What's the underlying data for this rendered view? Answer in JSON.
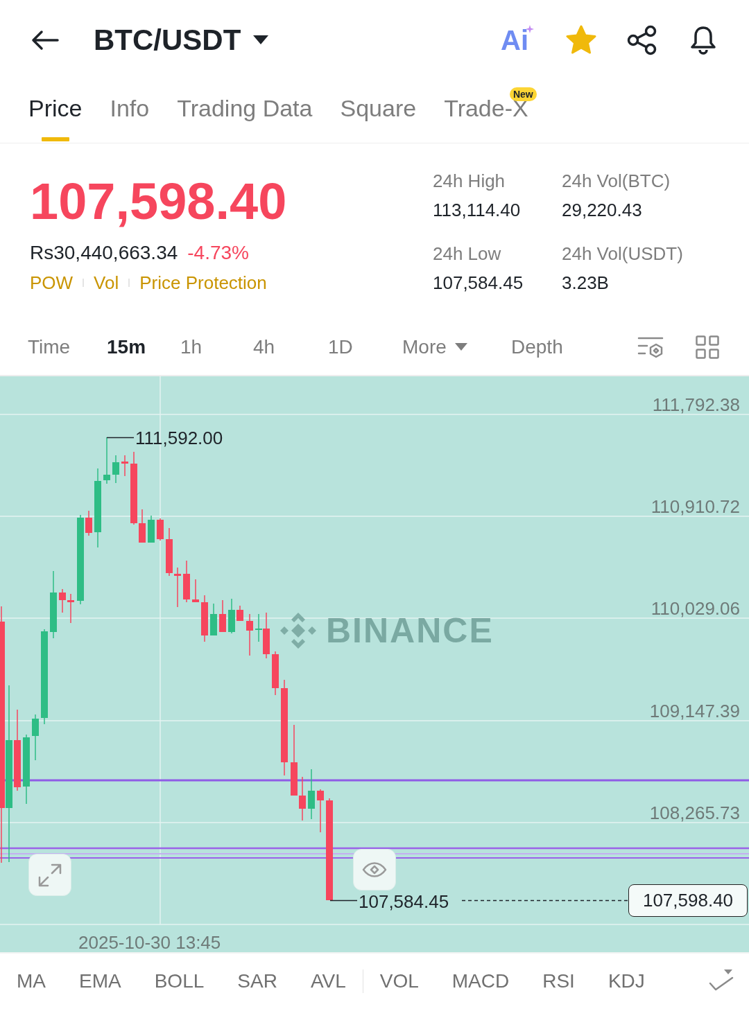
{
  "header": {
    "title": "BTC/USDT",
    "ai_label": "Ai",
    "favorite": true
  },
  "tabs": [
    {
      "label": "Price",
      "selected": true
    },
    {
      "label": "Info",
      "selected": false
    },
    {
      "label": "Trading Data",
      "selected": false
    },
    {
      "label": "Square",
      "selected": false
    },
    {
      "label": "Trade-X",
      "selected": false,
      "badge": "New"
    }
  ],
  "ticker": {
    "price": "107,598.40",
    "falling": true,
    "fiat_price": "Rs30,440,663.34",
    "change": "-4.73%",
    "tags": [
      "POW",
      "Vol",
      "Price Protection"
    ]
  },
  "stats": [
    {
      "label": "24h High",
      "value": "113,114.40"
    },
    {
      "label": "24h Vol(BTC)",
      "value": "29,220.43"
    },
    {
      "label": "24h Low",
      "value": "107,584.45"
    },
    {
      "label": "24h Vol(USDT)",
      "value": "3.23B"
    }
  ],
  "intervals": [
    {
      "label": "Time",
      "kind": "option",
      "selected": false
    },
    {
      "label": "15m",
      "kind": "option",
      "selected": true
    },
    {
      "label": "1h",
      "kind": "option",
      "selected": false
    },
    {
      "label": "4h",
      "kind": "option",
      "selected": false
    },
    {
      "label": "1D",
      "kind": "option",
      "selected": false
    },
    {
      "label": "More",
      "kind": "dropdown",
      "selected": false
    },
    {
      "label": "Depth",
      "kind": "option",
      "selected": false
    }
  ],
  "chart": {
    "logo_text": "BINANCE",
    "price_axis": [
      "111,792.38",
      "110,910.72",
      "110,029.06",
      "109,147.39",
      "108,265.73"
    ],
    "high_label": "111,592.00",
    "low_label": "107,584.45",
    "current_price": "107,598.40",
    "time_label": "2025-10-30 13:45"
  },
  "indicators": {
    "main": [
      "MA",
      "EMA",
      "BOLL",
      "SAR",
      "AVL"
    ],
    "sub": [
      "VOL",
      "MACD",
      "RSI",
      "KDJ"
    ]
  }
}
